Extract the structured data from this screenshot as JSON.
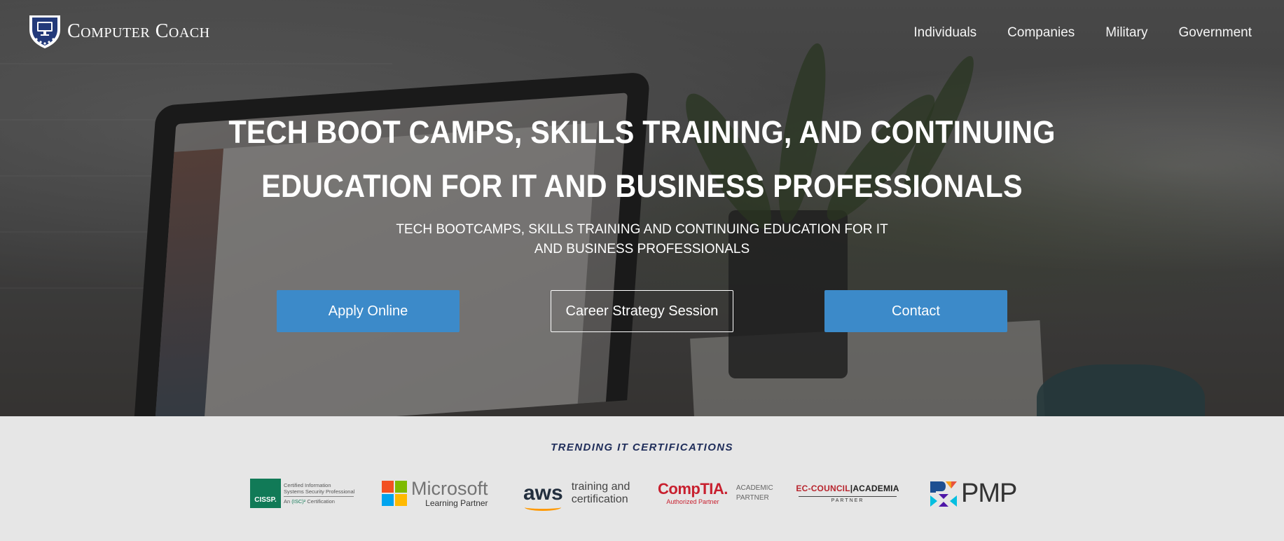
{
  "brand": {
    "name": "Computer Coach",
    "icon": "shield-monitor-icon"
  },
  "nav": {
    "items": [
      {
        "label": "Individuals"
      },
      {
        "label": "Companies"
      },
      {
        "label": "Military"
      },
      {
        "label": "Government"
      }
    ]
  },
  "hero": {
    "headline_line1": "TECH BOOT CAMPS, SKILLS TRAINING, AND CONTINUING",
    "headline_line2": "EDUCATION FOR IT AND BUSINESS PROFESSIONALS",
    "subhead_line1": "TECH BOOTCAMPS, SKILLS TRAINING AND CONTINUING EDUCATION FOR IT",
    "subhead_line2": "AND BUSINESS PROFESSIONALS",
    "buttons": {
      "apply": "Apply Online",
      "career": "Career Strategy Session",
      "contact": "Contact"
    }
  },
  "certifications": {
    "title": "TRENDING IT CERTIFICATIONS",
    "logos": {
      "cissp": {
        "badge": "CISSP.",
        "line1": "Certified Information",
        "line2": "Systems Security Professional",
        "line3_prefix": "An",
        "line3_org": "(ISC)²",
        "line3_suffix": "Certification"
      },
      "microsoft": {
        "name": "Microsoft",
        "sub": "Learning Partner"
      },
      "aws": {
        "word": "aws",
        "tag1": "training and",
        "tag2": "certification"
      },
      "comptia": {
        "name": "CompTIA.",
        "sub": "Authorized Partner",
        "acad1": "ACADEMIC",
        "acad2": "PARTNER"
      },
      "eccouncil": {
        "name": "EC-COUNCIL",
        "sep": "|",
        "acad": "ACADEMIA",
        "partner": "PARTNER"
      },
      "pmp": {
        "word": "PMP"
      }
    }
  },
  "colors": {
    "button_blue": "#3c8ac9",
    "cert_title": "#1f2d5a",
    "strip_bg": "#e6e6e6"
  }
}
